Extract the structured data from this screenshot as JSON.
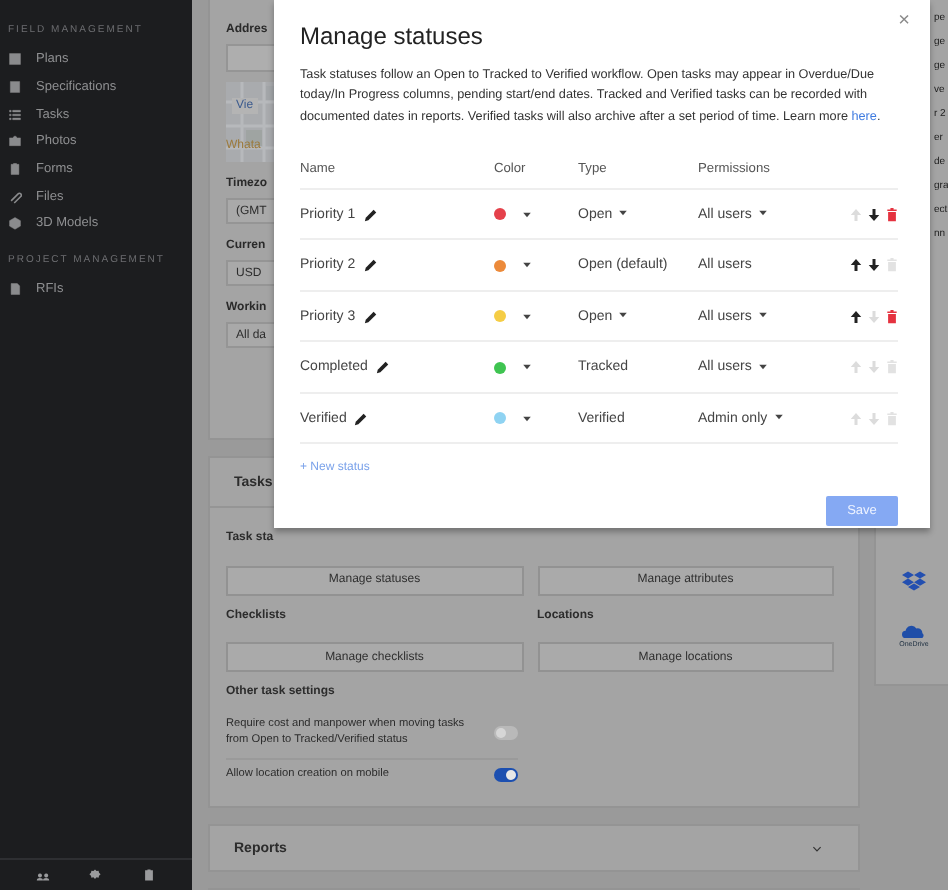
{
  "sidebar": {
    "sections": [
      {
        "heading": "FIELD MANAGEMENT",
        "items": [
          {
            "label": "Plans",
            "kind": "plans"
          },
          {
            "label": "Specifications",
            "kind": "book"
          },
          {
            "label": "Tasks",
            "kind": "list"
          },
          {
            "label": "Photos",
            "kind": "camera"
          },
          {
            "label": "Forms",
            "kind": "clipboard"
          },
          {
            "label": "Files",
            "kind": "clip"
          },
          {
            "label": "3D Models",
            "kind": "cube"
          }
        ]
      },
      {
        "heading": "PROJECT MANAGEMENT",
        "items": [
          {
            "label": "RFIs",
            "kind": "doc"
          }
        ]
      }
    ],
    "footer_icons": [
      {
        "kind": "people"
      },
      {
        "kind": "settings"
      },
      {
        "kind": "clipboard"
      }
    ]
  },
  "project_panel": {
    "address_label": "Addres",
    "map_link": "Vie",
    "map_note": "Whata",
    "fields": [
      {
        "label": "Timezo",
        "value": "(GMT"
      },
      {
        "label": "Curren",
        "value": "USD"
      },
      {
        "label": "Workin",
        "value": "All da"
      }
    ]
  },
  "tasks_panel": {
    "title": "Tasks",
    "groups": [
      {
        "items": [
          {
            "label": "Task sta",
            "button": "Manage statuses"
          },
          {
            "button": "Manage attributes"
          }
        ]
      },
      {
        "items": [
          {
            "label": "Checklists",
            "button": "Manage checklists"
          },
          {
            "label": "Locations",
            "button": "Manage locations"
          }
        ]
      }
    ],
    "other_settings": {
      "title": "Other task settings",
      "toggles": [
        {
          "label": "Require cost and manpower when moving tasks from Open to Tracked/Verified status",
          "on": false
        },
        {
          "label": "Allow location creation on mobile",
          "on": true
        }
      ]
    }
  },
  "reports_panel": {
    "title": "Reports",
    "expanded": false
  },
  "right_panel": {
    "fragments": [
      "pe",
      "ge",
      "ge",
      "ve",
      "r 2",
      "er",
      "de",
      "gra",
      "ect",
      "nn"
    ],
    "storage_icons": [
      {
        "kind": "dropbox"
      },
      {
        "kind": "onedrive",
        "label": "OneDrive"
      }
    ]
  },
  "modal": {
    "title": "Manage statuses",
    "close": "×",
    "description": "Task statuses follow an Open to Tracked to Verified workflow. Open tasks may appear in Overdue/Due today/In Progress columns, pending start/end dates. Tracked and Verified tasks can be recorded with documented dates in reports. Verified tasks will also archive after a set period of time. Learn more ",
    "link": "here",
    "description_end": ".",
    "columns": [
      "Name",
      "Color",
      "Type",
      "Permissions"
    ],
    "statuses": [
      {
        "name": "Priority 1",
        "color": "#e5414b",
        "type": "Open",
        "type_dropdown": true,
        "permissions": "All users",
        "permissions_dropdown": true,
        "up_enabled": false,
        "down_enabled": true,
        "delete_enabled": true
      },
      {
        "name": "Priority 2",
        "color": "#ec8a3a",
        "type": "Open (default)",
        "type_dropdown": false,
        "permissions": "All users",
        "permissions_dropdown": false,
        "up_enabled": true,
        "down_enabled": true,
        "delete_enabled": false
      },
      {
        "name": "Priority 3",
        "color": "#f5cd45",
        "type": "Open",
        "type_dropdown": true,
        "permissions": "All users",
        "permissions_dropdown": true,
        "up_enabled": true,
        "down_enabled": false,
        "delete_enabled": true
      },
      {
        "name": "Completed",
        "color": "#3fc451",
        "type": "Tracked",
        "type_dropdown": false,
        "permissions": "All users",
        "permissions_dropdown": true,
        "up_enabled": false,
        "down_enabled": false,
        "delete_enabled": false
      },
      {
        "name": "Verified",
        "color": "#8fd3f2",
        "type": "Verified",
        "type_dropdown": false,
        "permissions": "Admin only",
        "permissions_dropdown": true,
        "up_enabled": false,
        "down_enabled": false,
        "delete_enabled": false
      }
    ],
    "new_status": "+ New status",
    "save": {
      "label": "Save",
      "disabled": true
    }
  }
}
